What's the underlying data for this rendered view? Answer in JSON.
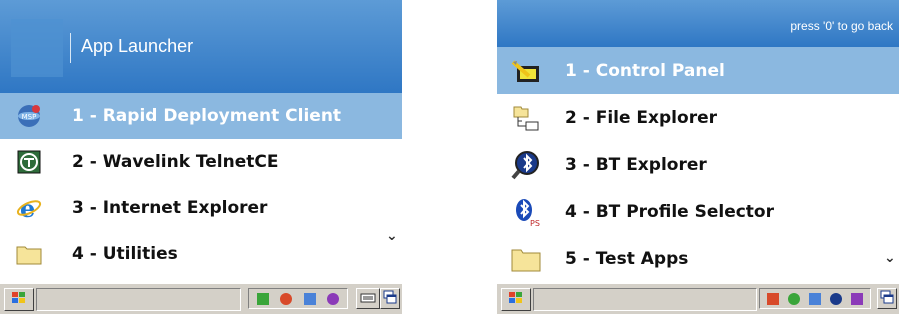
{
  "left_screen": {
    "header": {
      "title": "App Launcher"
    },
    "menu": [
      {
        "label": "1 - Rapid Deployment Client",
        "icon": "msp-icon",
        "selected": true
      },
      {
        "label": "2 - Wavelink TelnetCE",
        "icon": "wavelink-icon",
        "selected": false
      },
      {
        "label": "3 - Internet Explorer",
        "icon": "internet-explorer-icon",
        "selected": false
      },
      {
        "label": "4 - Utilities",
        "icon": "folder-icon",
        "selected": false
      }
    ],
    "scroll_indicator": "⌄"
  },
  "right_screen": {
    "header": {
      "hint": "press '0' to go back"
    },
    "menu": [
      {
        "label": "1 - Control Panel",
        "icon": "control-panel-icon",
        "selected": true
      },
      {
        "label": "2 - File Explorer",
        "icon": "file-explorer-icon",
        "selected": false
      },
      {
        "label": "3 - BT Explorer",
        "icon": "bluetooth-explorer-icon",
        "selected": false
      },
      {
        "label": "4 - BT Profile Selector",
        "icon": "bluetooth-ps-icon",
        "selected": false
      },
      {
        "label": "5 - Test Apps",
        "icon": "folder-icon",
        "selected": false
      }
    ],
    "scroll_indicator": "⌄"
  },
  "colors": {
    "header_top": "#5d9bd6",
    "header_bottom": "#2f77c4",
    "selected_row": "#8bb8e0",
    "taskbar": "#d4d0c8"
  }
}
